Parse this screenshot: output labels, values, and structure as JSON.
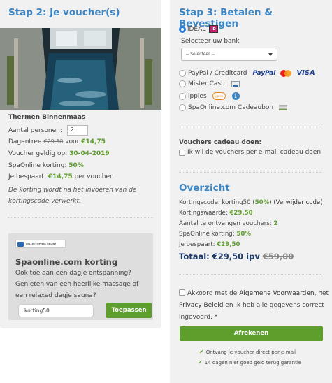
{
  "left": {
    "heading": "Stap 2: Je voucher(s)",
    "spa_name": "Thermen Binnenmaas",
    "persons_label": "Aantal personen:",
    "persons_value": "2",
    "price_prefix": "Dagentree",
    "price_old": "€29,50",
    "price_mid": "voor",
    "price_new": "€14,75",
    "valid_label": "Voucher geldig op:",
    "valid_date": "30-04-2019",
    "discount_label": "SpaOnline korting:",
    "discount_value": "50%",
    "saving_label": "Je bespaart:",
    "saving_value": "€14,75",
    "saving_suffix": "per voucher",
    "note": "De korting wordt na het invoeren van de kortingscode verwerkt.",
    "promo": {
      "logo_text": "COLLECTIEF SPA ONLINE",
      "title": "Spaonline.com korting",
      "text": "Ook toe aan een dagje ontspanning? Genieten van een heerlijke massage of een relaxed dagje sauna?",
      "code_value": "korting50",
      "apply_label": "Toepassen"
    }
  },
  "right": {
    "heading": "Stap 3: Betalen & Bevestigen",
    "ideal_label": "iDEAL",
    "ideal_logo": "iD",
    "bank_label": "Selecteer uw bank",
    "bank_select_value": "-- Selecteer --",
    "payment_methods": [
      {
        "label": "PayPal / Creditcard",
        "paypal": "PayPal",
        "visa": "VISA"
      },
      {
        "label": "Mister Cash"
      },
      {
        "label": "ipples",
        "logo_text": "ipples"
      },
      {
        "label": "SpaOnline.com Cadeaubon"
      }
    ],
    "gift_title": "Vouchers cadeau doen:",
    "gift_checkbox_label": "Ik wil de vouchers per e-mail cadeau doen",
    "overview": {
      "title": "Overzicht",
      "code_label": "Kortingscode: korting50 (",
      "code_pct": "50%",
      "code_mid": ") (",
      "remove_link": "Verwijder code",
      "code_end": ")",
      "value_label": "Kortingswaarde:",
      "value_amount": "€29,50",
      "count_label": "Aantal te ontvangen vouchers:",
      "count_value": "2",
      "discount_label": "SpaOnline korting:",
      "discount_value": "50%",
      "saving_label": "Je bespaart:",
      "saving_value": "€29,50",
      "total_label": "Totaal: €29,50 ipv",
      "total_old": "€59,00"
    },
    "terms": {
      "pre": "Akkoord met de",
      "link1": "Algemene Voorwaarden",
      "mid": ", het",
      "link2": "Privacy Beleid",
      "post": "en ik heb alle gegevens correct ingevoerd. *"
    },
    "order_label": "Afrekenen",
    "bullets": [
      "Ontvang je voucher direct per e-mail",
      "14 dagen niet goed geld terug garantie"
    ]
  }
}
